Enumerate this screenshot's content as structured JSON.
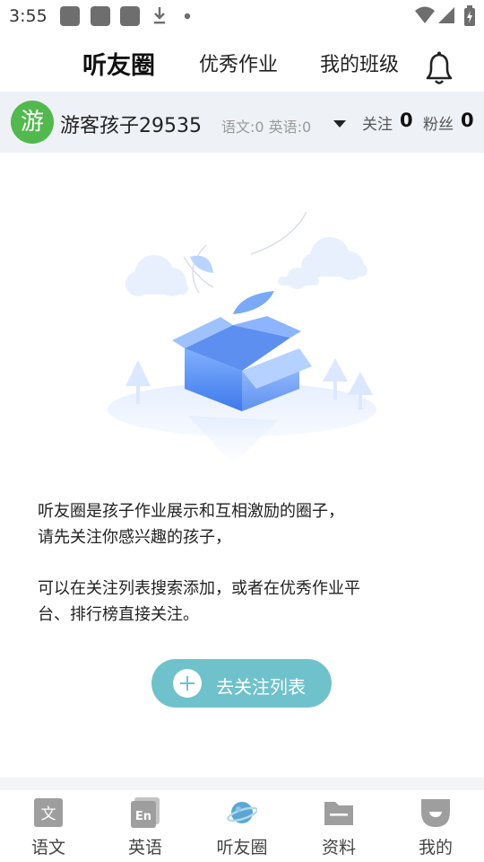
{
  "status_bar": {
    "time": "3:55"
  },
  "header": {
    "tabs": [
      {
        "label": "听友圈",
        "active": true
      },
      {
        "label": "优秀作业",
        "active": false
      },
      {
        "label": "我的班级",
        "active": false
      }
    ],
    "bell_icon": "bell-icon"
  },
  "user": {
    "avatar_text": "游",
    "avatar_color": "#52b94e",
    "name": "游客孩子29535",
    "scores": "语文:0 英语:0",
    "follow_label": "关注",
    "follow_count": "0",
    "fans_label": "粉丝",
    "fans_count": "0"
  },
  "empty_state": {
    "line1": "听友圈是孩子作业展示和互相激励的圈子，",
    "line2": "请先关注你感兴趣的孩子，",
    "line3": "可以在关注列表搜索添加，或者在优秀作业平",
    "line4": "台、排行榜直接关注。",
    "button_label": "去关注列表"
  },
  "colors": {
    "accent": "#6fc2cc",
    "box_blue": "#4a86f0"
  },
  "bottom_nav": [
    {
      "label": "语文",
      "icon": "chinese-book-icon",
      "active": false
    },
    {
      "label": "英语",
      "icon": "english-book-icon",
      "active": false
    },
    {
      "label": "听友圈",
      "icon": "planet-icon",
      "active": true
    },
    {
      "label": "资料",
      "icon": "folder-icon",
      "active": false
    },
    {
      "label": "我的",
      "icon": "profile-icon",
      "active": false
    }
  ]
}
